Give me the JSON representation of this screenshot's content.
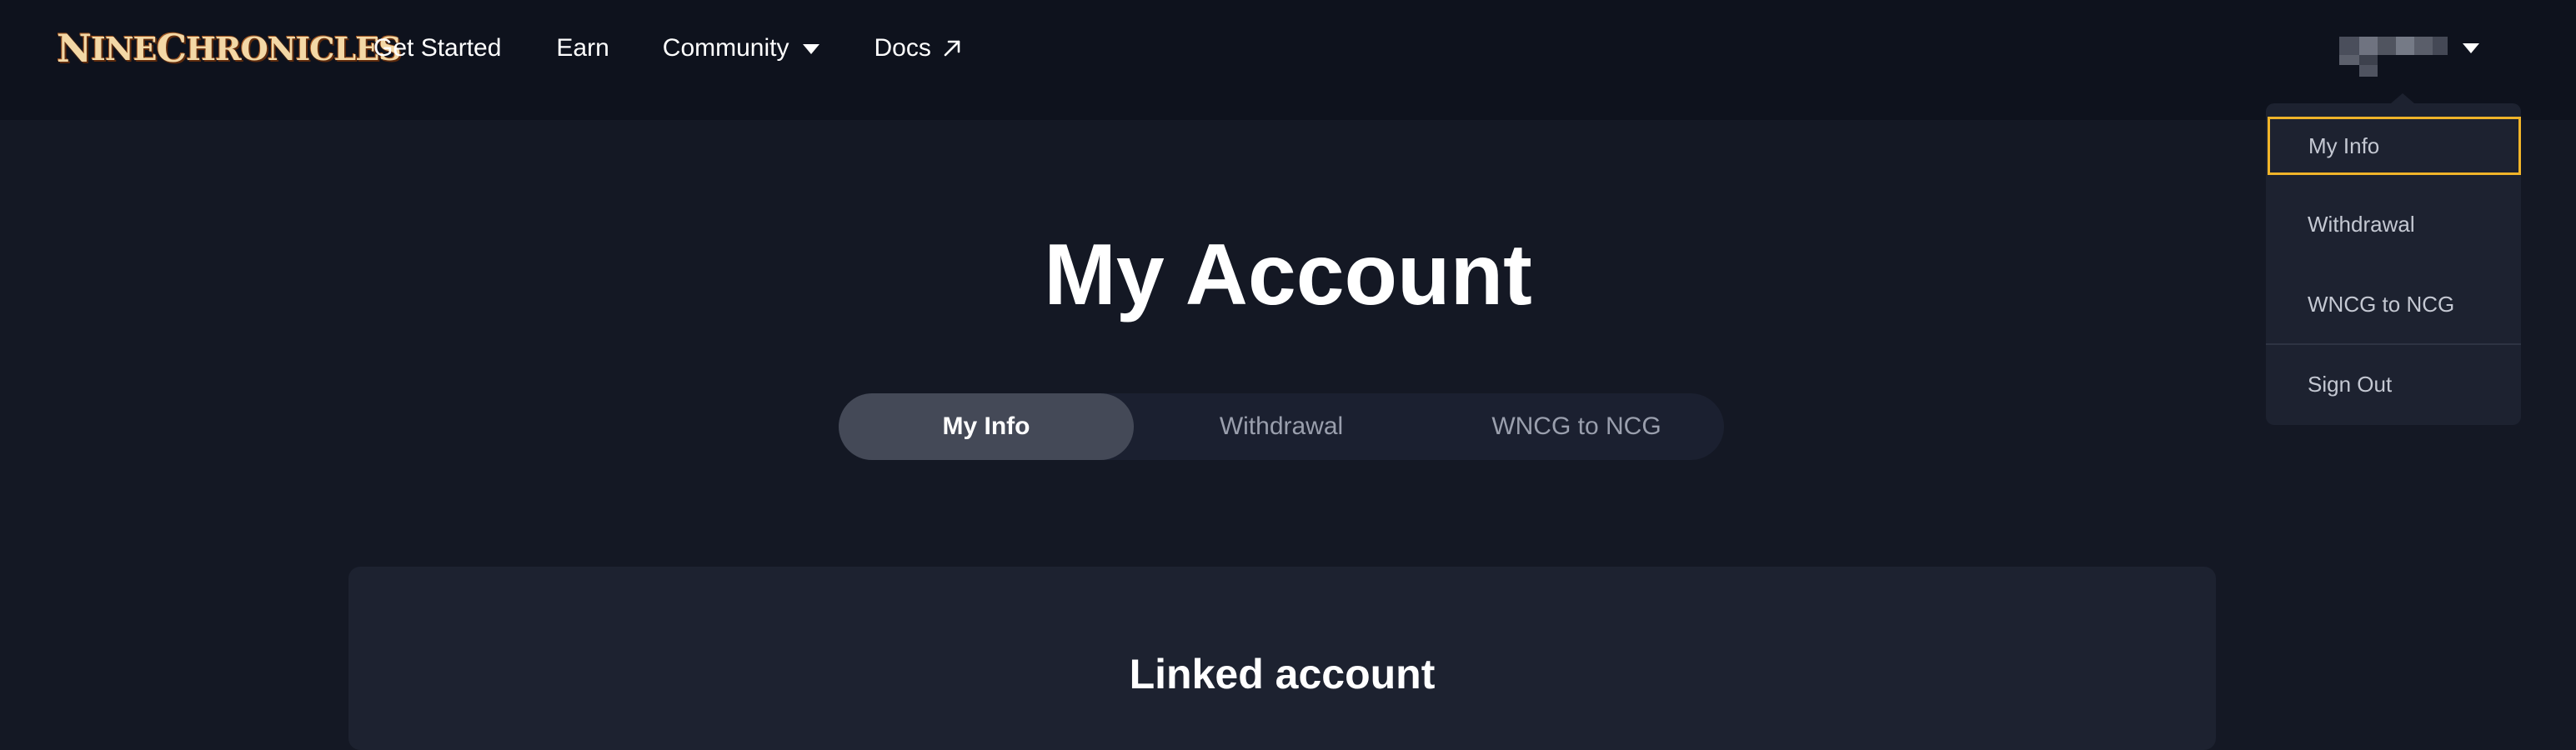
{
  "header": {
    "logo_text_first": "N",
    "logo_text_rest": "INE ",
    "logo_text_c": "C",
    "logo_text_end": "HRONICLES",
    "nav": {
      "get_started": "Get Started",
      "earn": "Earn",
      "community": "Community",
      "docs": "Docs"
    },
    "account_icon": "chevron-down-icon"
  },
  "dropdown": {
    "items": [
      {
        "label": "My Info"
      },
      {
        "label": "Withdrawal"
      },
      {
        "label": "WNCG to NCG"
      },
      {
        "label": "Sign Out"
      }
    ],
    "focus_color": "#f0b429"
  },
  "main": {
    "title": "My Account",
    "tabs": [
      {
        "label": "My Info",
        "active": true
      },
      {
        "label": "Withdrawal",
        "active": false
      },
      {
        "label": "WNCG to NCG",
        "active": false
      }
    ],
    "card": {
      "title": "Linked account"
    }
  },
  "colors": {
    "background": "#141824",
    "header": "#0e121d",
    "panel": "#1d2230"
  }
}
